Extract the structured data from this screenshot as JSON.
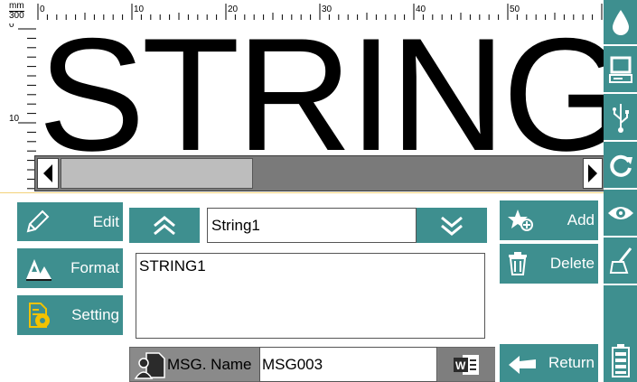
{
  "ruler": {
    "unit_top": "mm",
    "unit_bottom": "300",
    "h_ticks": [
      "0",
      "10",
      "20",
      "30",
      "40",
      "50"
    ],
    "v_ticks": [
      "0",
      "10"
    ]
  },
  "preview": {
    "text": "STRING"
  },
  "scrollbar": {
    "position_fraction": 0.0
  },
  "sidebar": {
    "items": [
      {
        "icon": "ink-drop-icon"
      },
      {
        "icon": "printer-screen-icon"
      },
      {
        "icon": "usb-icon"
      },
      {
        "icon": "refresh-icon"
      },
      {
        "icon": "eye-icon"
      },
      {
        "icon": "broom-icon"
      },
      {
        "icon": "battery-icon"
      }
    ]
  },
  "left_menu": {
    "edit": "Edit",
    "format": "Format",
    "setting": "Setting"
  },
  "field_selector": {
    "value": "String1"
  },
  "content_text": "STRING1",
  "right_menu": {
    "add": "Add",
    "delete": "Delete",
    "return": "Return"
  },
  "message": {
    "label": "MSG. Name",
    "value": "MSG003"
  },
  "colors": {
    "teal": "#3e8f8f",
    "gray_bar": "#7a7a7a",
    "thumb": "#bdbdbd"
  }
}
